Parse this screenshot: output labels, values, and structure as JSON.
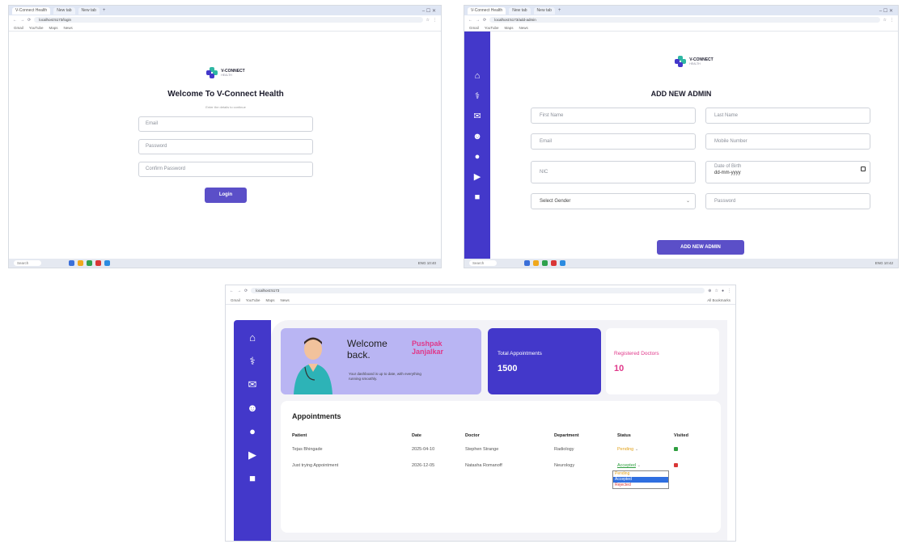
{
  "shot1": {
    "browser": {
      "tabs": [
        "V-Connect Health",
        "New tab",
        "New tab"
      ],
      "url": "localhost:5173/login",
      "bookmarks": [
        "Gmail",
        "YouTube",
        "Maps",
        "News"
      ]
    },
    "logo": {
      "name": "V-CONNECT",
      "sub": "HEALTH"
    },
    "title": "Welcome To V-Connect Health",
    "subtitle": "Enter the details to continue",
    "email_placeholder": "Email",
    "password_placeholder": "Password",
    "confirm_placeholder": "Confirm Password",
    "login_label": "Login",
    "taskbar": {
      "search": "Search",
      "right": "ENG 10:40"
    }
  },
  "shot2": {
    "browser": {
      "tabs": [
        "V-Connect Health",
        "New tab",
        "New tab"
      ],
      "url": "localhost:5173/add-admin",
      "bookmarks": [
        "Gmail",
        "YouTube",
        "Maps",
        "News"
      ]
    },
    "logo": {
      "name": "V-CONNECT",
      "sub": "HEALTH"
    },
    "title": "ADD NEW ADMIN",
    "fields": {
      "first_name": "First Name",
      "last_name": "Last Name",
      "email": "Email",
      "mobile": "Mobile Number",
      "nic": "NIC",
      "dob_label": "Date of Birth",
      "dob_value": "dd-mm-yyyy",
      "gender": "Select Gender",
      "password": "Password"
    },
    "button_label": "ADD NEW ADMIN",
    "taskbar": {
      "search": "Search",
      "right": "ENG 10:42"
    }
  },
  "shot3": {
    "browser": {
      "url": "localhost:5173",
      "bookmarks": [
        "Gmail",
        "YouTube",
        "Maps",
        "News"
      ],
      "right": "All Bookmarks"
    },
    "welcome": {
      "greeting": "Welcome back.",
      "name": "Pushpak Janjalkar",
      "subtitle": "Your dashboard is up to date, with everything running smoothly."
    },
    "total_appointments": {
      "label": "Total Appointments",
      "value": "1500"
    },
    "registered_doctors": {
      "label": "Registered Doctors",
      "value": "10"
    },
    "appointments": {
      "title": "Appointments",
      "columns": [
        "Patient",
        "Date",
        "Doctor",
        "Department",
        "Status",
        "Visited"
      ],
      "rows": [
        {
          "patient": "Tejas Bhingade",
          "date": "2025-04-10",
          "doctor": "Stephen Strange",
          "department": "Radiology",
          "status": "Pending",
          "visited": true
        },
        {
          "patient": "Just trying Appointment",
          "date": "2026-12-05",
          "doctor": "Natasha Romanoff",
          "department": "Neurology",
          "status": "Accepted",
          "visited": false
        }
      ],
      "status_options": [
        "Pending",
        "Accepted",
        "Rejected"
      ]
    }
  },
  "colors": {
    "brand": "#4338ca",
    "accent_pink": "#e0388a",
    "button": "#5b4fc8",
    "pending": "#e2a21b",
    "accepted": "#2e9e3f",
    "rejected": "#d93636"
  }
}
